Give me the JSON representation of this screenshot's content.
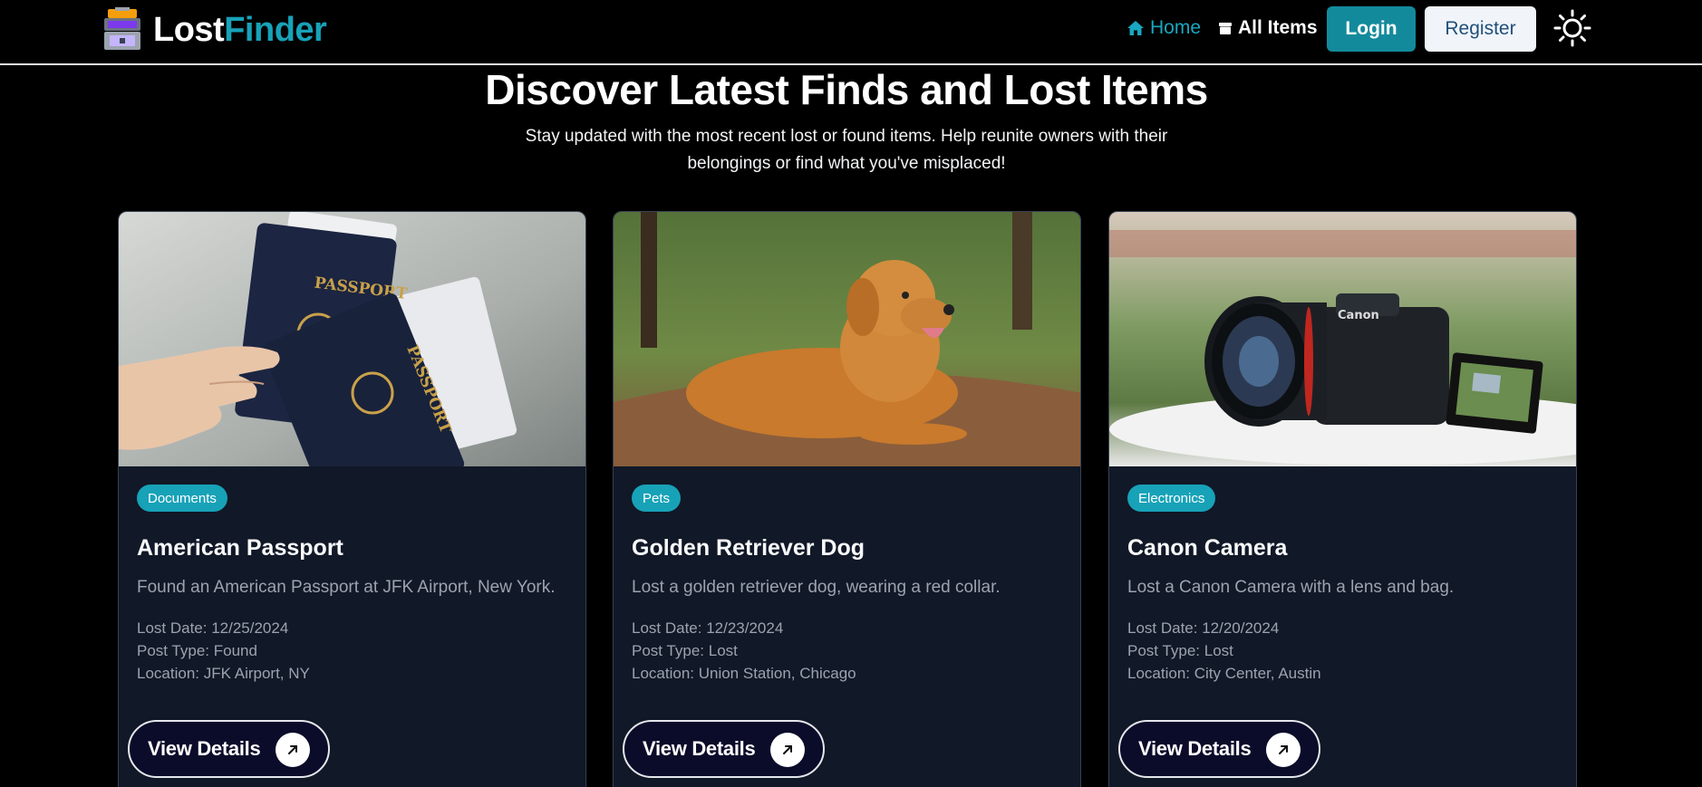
{
  "nav": {
    "brand_part1": "Lost",
    "brand_part2": "Finder",
    "home_label": "Home",
    "all_items_label": "All Items",
    "login_label": "Login",
    "register_label": "Register",
    "icons": [
      "luggage-logo-icon",
      "home-icon",
      "box-icon",
      "sun-icon"
    ]
  },
  "hero": {
    "title": "Discover Latest Finds and Lost Items",
    "subtitle": "Stay updated with the most recent lost or found items. Help reunite owners with their belongings or find what you've misplaced!"
  },
  "cards": [
    {
      "category": "Documents",
      "title": "American Passport",
      "description": "Found an American Passport at JFK Airport, New York.",
      "lost_date": "Lost Date: 12/25/2024",
      "post_type": "Post Type: Found",
      "location": "Location: JFK Airport, NY",
      "button": "View Details",
      "image_label": "PASSPORT"
    },
    {
      "category": "Pets",
      "title": "Golden Retriever Dog",
      "description": "Lost a golden retriever dog, wearing a red collar.",
      "lost_date": "Lost Date: 12/23/2024",
      "post_type": "Post Type: Lost",
      "location": "Location: Union Station, Chicago",
      "button": "View Details"
    },
    {
      "category": "Electronics",
      "title": "Canon Camera",
      "description": "Lost a Canon Camera with a lens and bag.",
      "lost_date": "Lost Date: 12/20/2024",
      "post_type": "Post Type: Lost",
      "location": "Location: City Center, Austin",
      "button": "View Details",
      "image_label": "Canon"
    }
  ],
  "colors": {
    "accent": "#17a2b8",
    "background": "#000000",
    "card_bg": "#111827",
    "login_bg": "#138a9c"
  }
}
